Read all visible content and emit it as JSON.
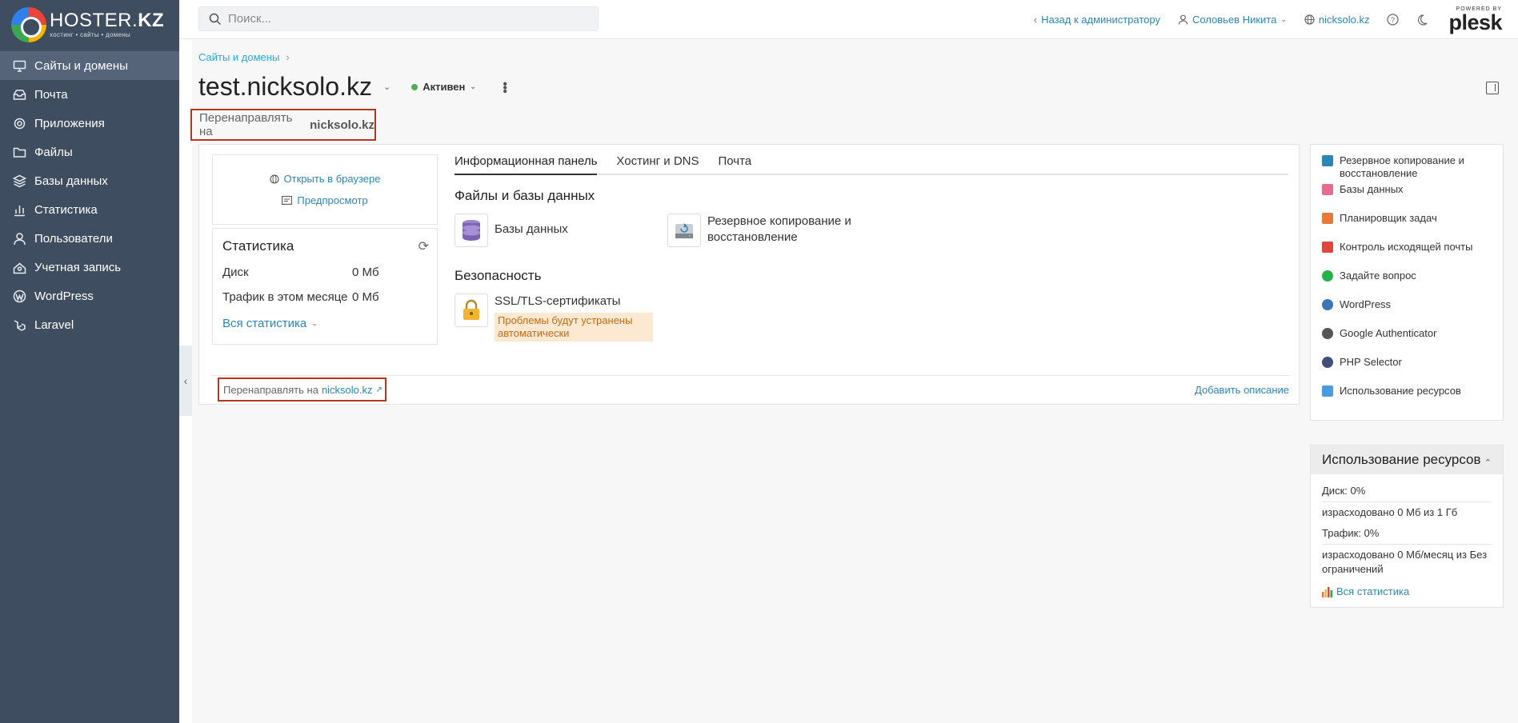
{
  "brand": {
    "name_a": "HOSTER.",
    "name_b": "KZ",
    "tagline": "хостинг • сайты • домены"
  },
  "sidebar": {
    "items": [
      {
        "label": "Сайты и домены",
        "icon": "monitor-icon",
        "active": true
      },
      {
        "label": "Почта",
        "icon": "mail-icon"
      },
      {
        "label": "Приложения",
        "icon": "gear-icon"
      },
      {
        "label": "Файлы",
        "icon": "folder-icon"
      },
      {
        "label": "Базы данных",
        "icon": "layers-icon"
      },
      {
        "label": "Статистика",
        "icon": "bar-chart-icon"
      },
      {
        "label": "Пользователи",
        "icon": "user-icon"
      },
      {
        "label": "Учетная запись",
        "icon": "account-icon"
      },
      {
        "label": "WordPress",
        "icon": "wordpress-icon"
      },
      {
        "label": "Laravel",
        "icon": "laravel-icon"
      }
    ]
  },
  "topbar": {
    "search_placeholder": "Поиск...",
    "back_label": "Назад к администратору",
    "user_name": "Соловьев Никита",
    "domain": "nicksolo.kz",
    "powered_by": "POWERED BY",
    "plesk": "plesk"
  },
  "breadcrumb": {
    "item": "Сайты и домены"
  },
  "page": {
    "title": "test.nicksolo.kz",
    "status": "Активен",
    "redirect_prefix": "Перенаправлять на",
    "redirect_target": "nicksolo.kz"
  },
  "left": {
    "open_browser": "Открыть в браузере",
    "preview": "Предпросмотр",
    "stats_title": "Статистика",
    "disk_label": "Диск",
    "disk_value": "0 Мб",
    "traffic_label": "Трафик в этом месяце",
    "traffic_value": "0 Мб",
    "all_stats": "Вся статистика"
  },
  "tabs": [
    {
      "label": "Информационная панель",
      "active": true
    },
    {
      "label": "Хостинг и DNS"
    },
    {
      "label": "Почта"
    }
  ],
  "sections": {
    "files_title": "Файлы и базы данных",
    "db_label": "Базы данных",
    "backup_label": "Резервное копирование и восстановление",
    "security_title": "Безопасность",
    "ssl_label": "SSL/TLS-сертификаты",
    "ssl_warning": "Проблемы будут устранены автоматически"
  },
  "footer": {
    "redirect_prefix": "Перенаправлять на",
    "redirect_target": "nicksolo.kz",
    "add_description": "Добавить описание"
  },
  "right_panel": {
    "items": [
      {
        "label": "Резервное копирование и восстановление",
        "color": "#2a86b5"
      },
      {
        "label": "Базы данных",
        "color": "#e56b8f"
      },
      {
        "label": "Планировщик задач",
        "color": "#e57b3a"
      },
      {
        "label": "Контроль исходящей почты",
        "color": "#e0463e"
      },
      {
        "label": "Задайте вопрос",
        "color": "#25b24b"
      },
      {
        "label": "WordPress",
        "color": "#3b76b5"
      },
      {
        "label": "Google Authenticator",
        "color": "#555555"
      },
      {
        "label": "PHP Selector",
        "color": "#3d4f7a"
      },
      {
        "label": "Использование ресурсов",
        "color": "#4a9be0"
      }
    ]
  },
  "resources": {
    "title": "Использование ресурсов",
    "disk": "Диск: 0%",
    "disk_used": "израсходовано 0 Мб из 1 Гб",
    "traffic": "Трафик: 0%",
    "traffic_used": "израсходовано 0 Мб/месяц из Без ограничений",
    "all_stats": "Вся статистика"
  },
  "colors": {
    "sidebar_bg": "#3f4d60",
    "sidebar_active": "#556479",
    "link": "#2a86b5",
    "highlight_box": "#b5361c",
    "status_ok": "#4caf50",
    "warning_bg": "#fde9d2",
    "warning_text": "#c26b12"
  }
}
